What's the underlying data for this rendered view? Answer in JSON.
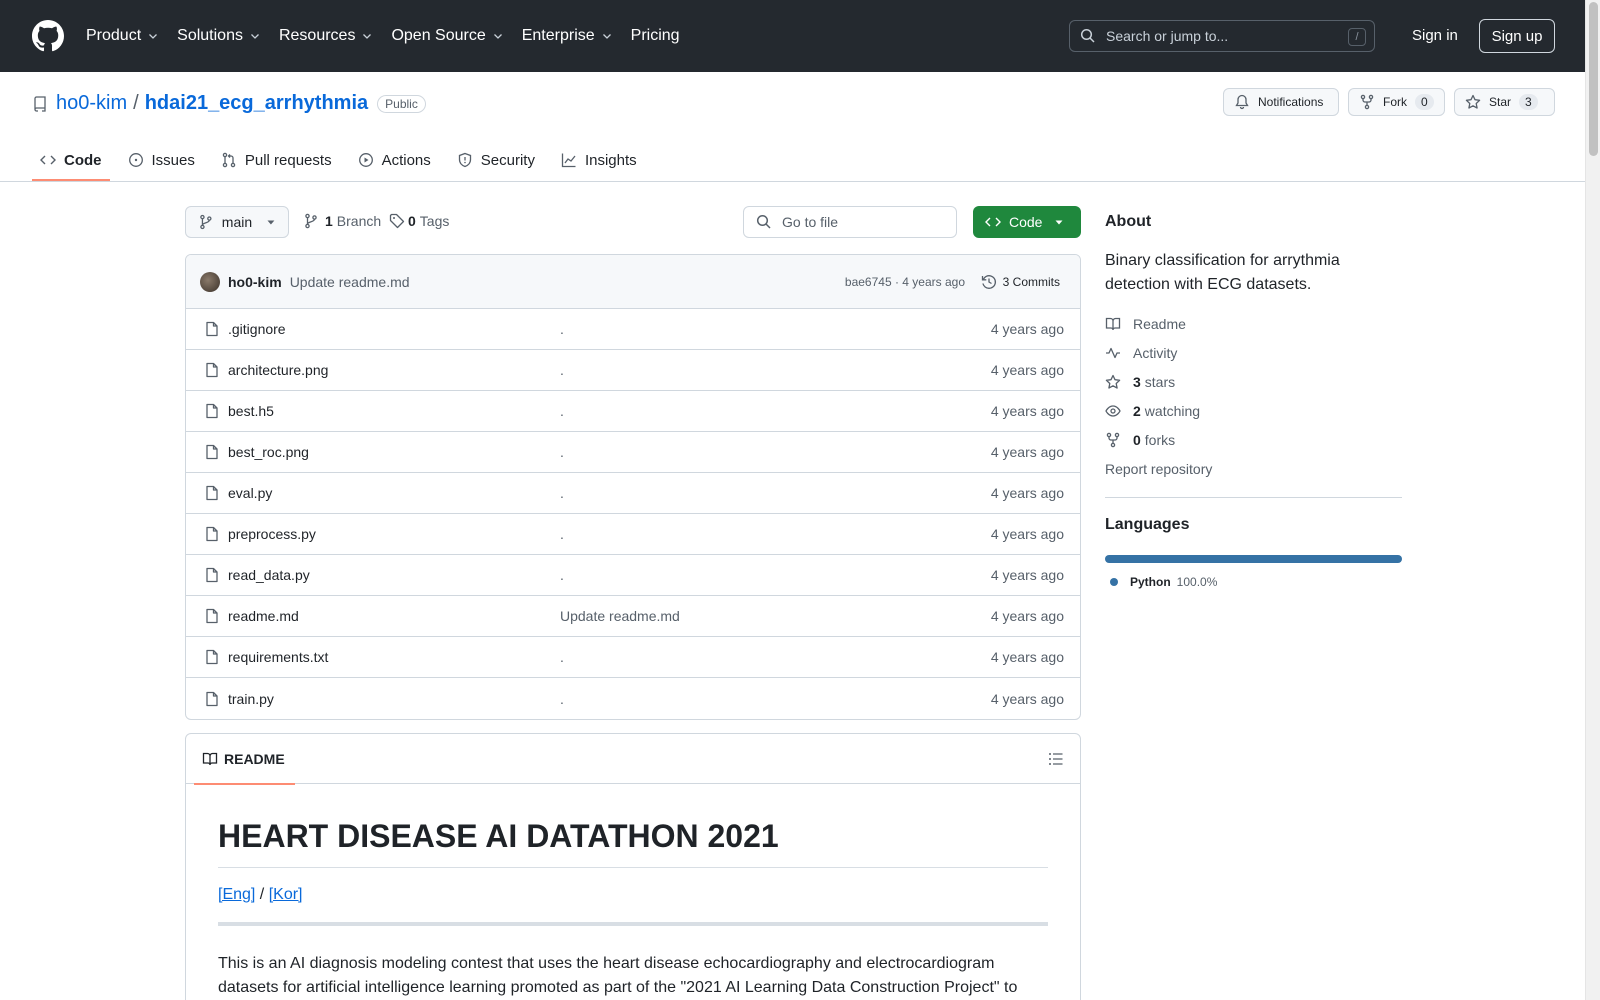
{
  "header": {
    "nav": [
      "Product",
      "Solutions",
      "Resources",
      "Open Source",
      "Enterprise",
      "Pricing"
    ],
    "search_placeholder": "Search or jump to...",
    "search_shortcut": "/",
    "sign_in": "Sign in",
    "sign_up": "Sign up"
  },
  "repo": {
    "owner": "ho0-kim",
    "separator": "/",
    "name": "hdai21_ecg_arrhythmia",
    "visibility": "Public",
    "notifications_label": "Notifications",
    "fork_label": "Fork",
    "fork_count": "0",
    "star_label": "Star",
    "star_count": "3"
  },
  "tabs": [
    "Code",
    "Issues",
    "Pull requests",
    "Actions",
    "Security",
    "Insights"
  ],
  "toolbar": {
    "branch": "main",
    "branch_count": "1",
    "branch_label": "Branch",
    "tag_count": "0",
    "tag_label": "Tags",
    "go_to_file": "Go to file",
    "code_button": "Code"
  },
  "commit": {
    "author": "ho0-kim",
    "message": "Update readme.md",
    "meta": "bae6745 · 4 years ago",
    "commits": "3 Commits"
  },
  "files": [
    {
      "name": ".gitignore",
      "message": ".",
      "date": "4 years ago"
    },
    {
      "name": "architecture.png",
      "message": ".",
      "date": "4 years ago"
    },
    {
      "name": "best.h5",
      "message": ".",
      "date": "4 years ago"
    },
    {
      "name": "best_roc.png",
      "message": ".",
      "date": "4 years ago"
    },
    {
      "name": "eval.py",
      "message": ".",
      "date": "4 years ago"
    },
    {
      "name": "preprocess.py",
      "message": ".",
      "date": "4 years ago"
    },
    {
      "name": "read_data.py",
      "message": ".",
      "date": "4 years ago"
    },
    {
      "name": "readme.md",
      "message": "Update readme.md",
      "date": "4 years ago"
    },
    {
      "name": "requirements.txt",
      "message": ".",
      "date": "4 years ago"
    },
    {
      "name": "train.py",
      "message": ".",
      "date": "4 years ago"
    }
  ],
  "readme": {
    "tab": "README",
    "title": "HEART DISEASE AI DATATHON 2021",
    "link_eng": "[Eng]",
    "link_sep": " / ",
    "link_kor": "[Kor]",
    "paragraph": "This is an AI diagnosis modeling contest that uses the heart disease echocardiography and electrocardiogram datasets for artificial intelligence learning promoted as part of the \"2021 AI Learning Data Construction Project\" to"
  },
  "sidebar": {
    "about_title": "About",
    "description": "Binary classification for arrythmia detection with ECG datasets.",
    "readme": "Readme",
    "activity": "Activity",
    "stars_count": "3",
    "stars_label": "stars",
    "watching_count": "2",
    "watching_label": "watching",
    "forks_count": "0",
    "forks_label": "forks",
    "report": "Report repository",
    "languages_title": "Languages",
    "language_name": "Python",
    "language_pct": "100.0%",
    "language_color": "#3572a5"
  }
}
